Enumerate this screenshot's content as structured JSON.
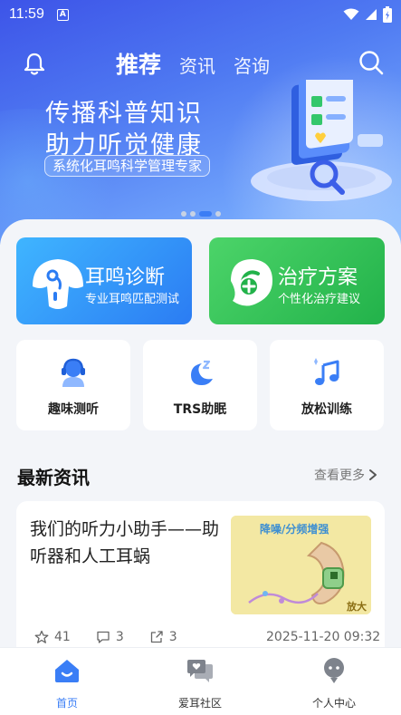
{
  "status_bar": {
    "time": "11:59",
    "indicator": "A"
  },
  "top_nav": {
    "tabs": [
      {
        "label": "推荐",
        "active": true
      },
      {
        "label": "资讯",
        "active": false
      },
      {
        "label": "咨询",
        "active": false
      }
    ]
  },
  "banner": {
    "line1": "传播科普知识",
    "line2": "助力听觉健康",
    "sub": "系统化耳鸣科学管理专家",
    "page_count": 4,
    "active_index": 2
  },
  "features": [
    {
      "title": "耳鸣诊断",
      "subtitle": "专业耳鸣匹配测试",
      "color": "#2b7cf3",
      "icon": "mushroom-ear-icon"
    },
    {
      "title": "治疗方案",
      "subtitle": "个性化治疗建议",
      "color": "#22b24a",
      "icon": "ear-plus-icon"
    }
  ],
  "tools": [
    {
      "label": "趣味测听",
      "icon": "headset-user-icon"
    },
    {
      "label": "TRS助眠",
      "icon": "moon-sleep-icon"
    },
    {
      "label": "放松训练",
      "icon": "music-note-icon"
    }
  ],
  "news": {
    "header": "最新资讯",
    "more": "查看更多",
    "items": [
      {
        "title": "我们的听力小助手——助听器和人工耳蜗",
        "likes": "41",
        "comments": "3",
        "shares": "3",
        "time": "2025-11-20 09:32",
        "thumb_text_top": "降噪/分频增强",
        "thumb_text_corner": "放大"
      }
    ]
  },
  "bottom_nav": [
    {
      "label": "首页",
      "active": true,
      "icon": "home-icon"
    },
    {
      "label": "爱耳社区",
      "active": false,
      "icon": "community-chat-icon"
    },
    {
      "label": "个人中心",
      "active": false,
      "icon": "profile-icon"
    }
  ],
  "colors": {
    "accent": "#3a7ef6",
    "green": "#22b24a"
  }
}
